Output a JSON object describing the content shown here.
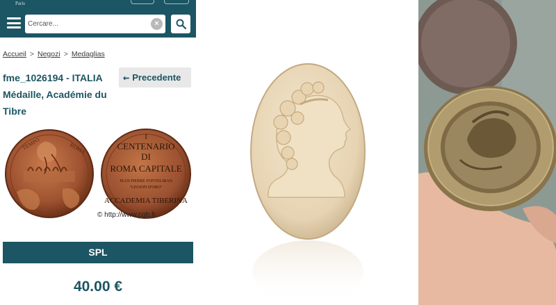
{
  "header": {
    "logo_tagline": "Paris",
    "search_placeholder": "Cercare...",
    "clear_label": "×"
  },
  "breadcrumb": [
    "Accueil",
    "Negozi",
    "Medaglias"
  ],
  "product": {
    "title": "fme_1026194 - ITALIA Médaille, Académie du Tibre",
    "prev_label": "Precedente",
    "watermark": "© http://www.cgb.fr",
    "medal_obverse_text": [
      "TEMPO",
      "ROMA"
    ],
    "medal_reverse_text": [
      "I",
      "CENTENARIO",
      "DI",
      "ROMA CAPITALE",
      "JEAN PIERRE FONTELIRAN",
      "\"LEGION D'ORO\"",
      "ACCADEMIA TIBERINA"
    ],
    "grade": "SPL",
    "price": "40.00 €"
  },
  "colors": {
    "brand": "#1c5563",
    "bronze": "#a35a35",
    "cameo": "#ecdcbf",
    "tray": "#a8946a"
  }
}
